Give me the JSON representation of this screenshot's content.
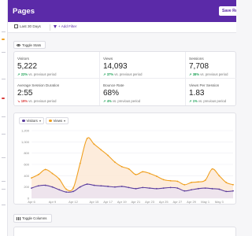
{
  "header": {
    "title": "Pages",
    "save_label": "Save Report"
  },
  "filters": {
    "date_range": "Last 30 Days",
    "add_filter": "+ Add Filter"
  },
  "toggle_stats_label": "Toggle Stats",
  "toggle_columns_label": "Toggle Columns",
  "stats": [
    {
      "label": "Visitors",
      "value": "5,222",
      "change": "22%",
      "direction": "up",
      "suffix": "vs. previous period"
    },
    {
      "label": "Views",
      "value": "14,093",
      "change": "37%",
      "direction": "up",
      "suffix": "vs. previous period"
    },
    {
      "label": "Sessions",
      "value": "7,708",
      "change": "38%",
      "direction": "up",
      "suffix": "vs. previous period"
    },
    {
      "label": "Average Session Duration",
      "value": "2:55",
      "change": "19%",
      "direction": "down",
      "suffix": "vs. previous period"
    },
    {
      "label": "Bounce Rate",
      "value": "68%",
      "change": "4%",
      "direction": "up",
      "suffix": "vs. previous period"
    },
    {
      "label": "Views Per Session",
      "value": "1.83",
      "change": "1%",
      "direction": "up",
      "suffix": "vs. previous period"
    }
  ],
  "chart_controls": {
    "visitors_label": "Visitors",
    "views_label": "Views"
  },
  "colors": {
    "header": "#5b2aa8",
    "visitors": "#5d3f9e",
    "views": "#f0a020",
    "views_fill": "#fde9d6",
    "up": "#21a35a",
    "down": "#d93b3b"
  },
  "chart_data": {
    "type": "area",
    "x": [
      "Apr 6",
      "Apr 7",
      "Apr 8",
      "Apr 9",
      "Apr 10",
      "Apr 11",
      "Apr 12",
      "Apr 13",
      "Apr 14",
      "Apr 15",
      "Apr 16",
      "Apr 17",
      "Apr 18",
      "Apr 19",
      "Apr 20",
      "Apr 21",
      "Apr 22",
      "Apr 23",
      "Apr 24",
      "Apr 25",
      "Apr 26",
      "Apr 27",
      "Apr 28",
      "Apr 29",
      "Apr 30",
      "May 1",
      "May 2",
      "May 3",
      "May 4",
      "May 5"
    ],
    "x_tick_labels": [
      "Apr 6",
      "Apr 9",
      "Apr 12",
      "Apr 15",
      "Apr 17",
      "Apr 19",
      "Apr 21",
      "Apr 23",
      "Apr 25",
      "Apr 27",
      "Apr 29",
      "May 1",
      "May 3"
    ],
    "y_ticks": [
      0,
      200,
      400,
      600,
      800,
      1000,
      1200
    ],
    "ylim": [
      0,
      1200
    ],
    "series": [
      {
        "name": "Visitors",
        "values": [
          180,
          220,
          230,
          200,
          150,
          110,
          120,
          200,
          250,
          230,
          220,
          210,
          200,
          210,
          190,
          170,
          190,
          180,
          170,
          180,
          190,
          180,
          130,
          150,
          170,
          180,
          170,
          160,
          120,
          130
        ]
      },
      {
        "name": "Views",
        "values": [
          360,
          420,
          510,
          440,
          340,
          160,
          180,
          620,
          1060,
          960,
          860,
          760,
          640,
          560,
          520,
          420,
          470,
          440,
          390,
          330,
          310,
          300,
          240,
          280,
          290,
          320,
          520,
          400,
          280,
          240
        ]
      }
    ]
  }
}
